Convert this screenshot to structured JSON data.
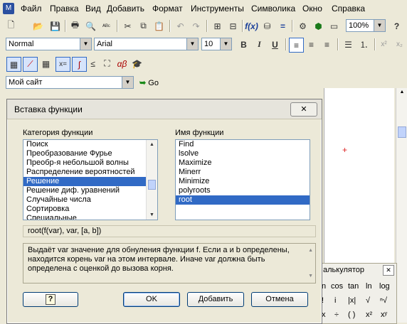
{
  "menubar": {
    "items": [
      "Файл",
      "Правка",
      "Вид",
      "Добавить",
      "Формат",
      "Инструменты",
      "Символика",
      "Окно",
      "Справка"
    ]
  },
  "toolbar": {
    "zoom": "100%"
  },
  "format_bar": {
    "style": "Normal",
    "font": "Arial",
    "size": "10"
  },
  "resources": {
    "site": "Мой сайт",
    "go": "Go"
  },
  "dialog": {
    "title": "Вставка функции",
    "close": "✕",
    "category_label": "Категория функции",
    "categories": [
      "Поиск",
      "Преобразование Фурье",
      "Преобр-я небольшой волны",
      "Распределение вероятностей",
      "Решение",
      "Решение диф. уравнений",
      "Случайные числа",
      "Сортировка",
      "Специальные"
    ],
    "function_label": "Имя функции",
    "functions": [
      "Find",
      "lsolve",
      "Maximize",
      "Minerr",
      "Minimize",
      "polyroots",
      "root"
    ],
    "syntax": "root(f(var), var, [a, b])",
    "description": "Выдаёт var значение для обнуления функции f. Если a и b определены, находится корень var на этом интервале. Иначе var должна быть определена с оценкой до вызова корня.",
    "help": "?",
    "ok": "OK",
    "insert": "Добавить",
    "cancel": "Отмена"
  },
  "calculator": {
    "title": "алькулятор",
    "close": "✕",
    "row1": [
      "n",
      "cos",
      "tan",
      "ln",
      "log"
    ],
    "row2": [
      "!",
      "i",
      "|x|",
      "√",
      "ⁿ√"
    ],
    "row3": [
      "x",
      "÷",
      "( )",
      "x²",
      "xʸ"
    ]
  }
}
